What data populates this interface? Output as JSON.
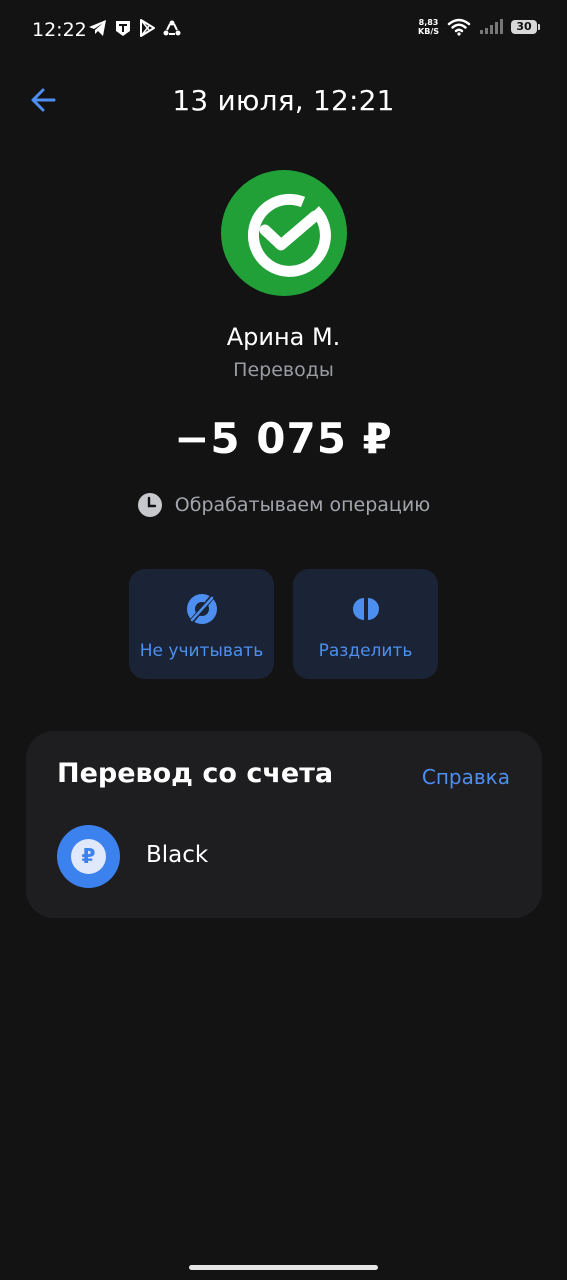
{
  "status_bar": {
    "time": "12:22",
    "net_speed_value": "8,83",
    "net_speed_unit": "KB/S",
    "battery": "30",
    "icons_left": [
      "telegram-icon",
      "app-t-icon",
      "play-store-icon",
      "recycle-icon"
    ],
    "icons_right": [
      "wifi-icon",
      "signal-icon",
      "battery-icon"
    ]
  },
  "header": {
    "title": "13 июля, 12:21"
  },
  "transaction": {
    "recipient": "Арина М.",
    "category": "Переводы",
    "amount": "−5 075 ₽",
    "status": "Обрабатываем операцию"
  },
  "actions": [
    {
      "label": "Не учитывать",
      "icon": "exclude-icon"
    },
    {
      "label": "Разделить",
      "icon": "split-icon"
    }
  ],
  "account_card": {
    "title": "Перевод со счета",
    "help_label": "Справка",
    "account_name": "Black",
    "account_icon_glyph": "₽"
  },
  "colors": {
    "background": "#131313",
    "accent": "#4d8ff0",
    "merchant_green": "#21a038",
    "card": "#1e1e20",
    "action_bg": "#1b2436"
  }
}
